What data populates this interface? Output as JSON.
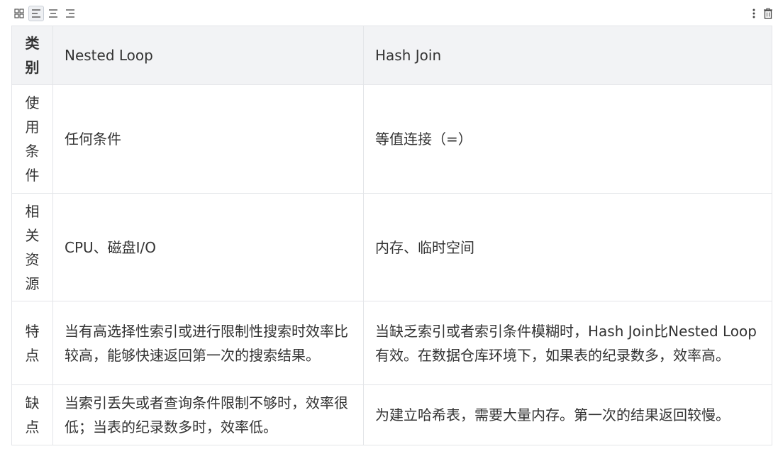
{
  "toolbar": {
    "buttons": [
      {
        "icon": "grid-icon",
        "active": false
      },
      {
        "icon": "align-left-icon",
        "active": true
      },
      {
        "icon": "align-center-icon",
        "active": false
      },
      {
        "icon": "align-right-icon",
        "active": false
      }
    ],
    "right_icons": [
      "more-vertical-icon",
      "trash-icon"
    ]
  },
  "table": {
    "headers": {
      "category": "类别",
      "col1": "Nested Loop",
      "col2": "Hash Join"
    },
    "rows": [
      {
        "category": "使用条件",
        "col1": "任何条件",
        "col2": "等值连接（=）"
      },
      {
        "category": "相关资源",
        "col1": "CPU、磁盘I/O",
        "col2": "内存、临时空间"
      },
      {
        "category": "特点",
        "col1": "当有高选择性索引或进行限制性搜索时效率比较高，能够快速返回第一次的搜索结果。",
        "col2": "当缺乏索引或者索引条件模糊时，Hash Join比Nested Loop有效。在数据仓库环境下，如果表的纪录数多，效率高。"
      },
      {
        "category": "缺点",
        "col1": "当索引丢失或者查询条件限制不够时，效率很低；当表的纪录数多时，效率低。",
        "col2": "为建立哈希表，需要大量内存。第一次的结果返回较慢。"
      }
    ]
  }
}
